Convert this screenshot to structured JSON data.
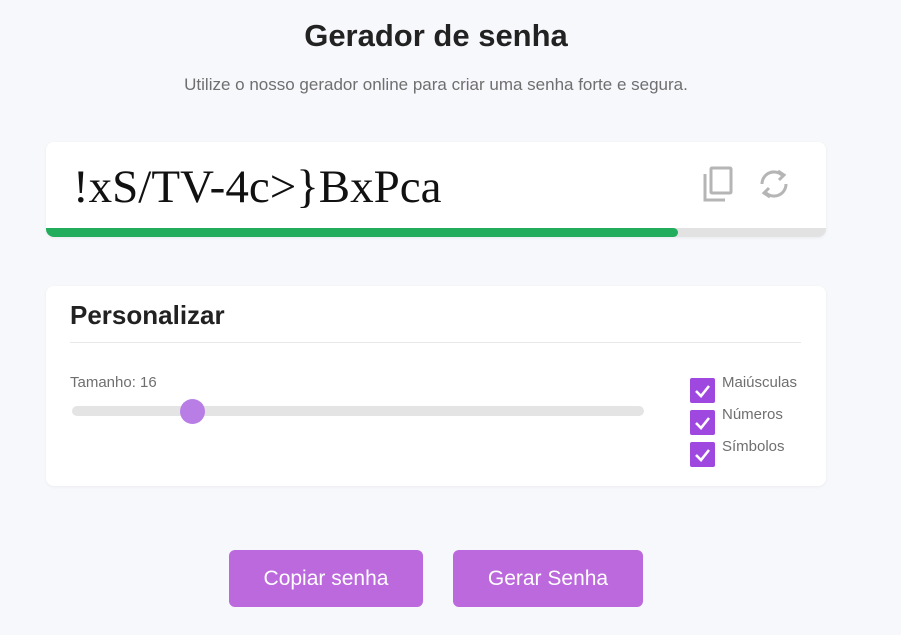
{
  "header": {
    "title": "Gerador de senha",
    "subtitle": "Utilize o nosso gerador online para criar uma senha forte e segura."
  },
  "password": {
    "value": "!xS/TV-4c>}BxPca",
    "strength_percent": 81,
    "strength_color": "#21ad5b",
    "icons": [
      "copy-icon",
      "refresh-icon"
    ]
  },
  "customize": {
    "title": "Personalizar",
    "length_label": "Tamanho: 16",
    "length_value": 16,
    "slider_fraction": 0.21,
    "options": [
      {
        "label": "Maiúsculas",
        "checked": true
      },
      {
        "label": "Números",
        "checked": true
      },
      {
        "label": "Símbolos",
        "checked": true
      }
    ]
  },
  "actions": {
    "copy_label": "Copiar senha",
    "generate_label": "Gerar Senha"
  },
  "colors": {
    "accent": "#bb69dd",
    "checkbox": "#9f48e0",
    "background": "#f7f8fc"
  }
}
